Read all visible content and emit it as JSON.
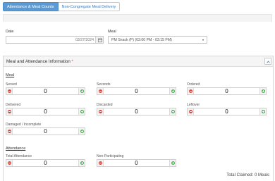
{
  "tabs": [
    {
      "label": "Attendance & Meal Counts",
      "active": true
    },
    {
      "label": "Non-Congregate Meal Delivery",
      "active": false
    }
  ],
  "date": {
    "label": "Date",
    "value": "03/27/2024",
    "icon": "calendar-icon"
  },
  "meal": {
    "label": "Meal",
    "value": "PM Snack (P) (03:00 PM - 03:15 PM)",
    "icon": "chevron-down-icon"
  },
  "panel": {
    "title": "Meal and Attendance Information",
    "required_mark": "*",
    "icon": "chevron-up-icon"
  },
  "meal_section": {
    "title": "Meal",
    "fields": [
      {
        "label": "Served",
        "value": "0"
      },
      {
        "label": "Seconds",
        "value": "0"
      },
      {
        "label": "Ordered",
        "value": "0"
      },
      {
        "label": "Delivered",
        "value": "0"
      },
      {
        "label": "Discarded",
        "value": "0"
      },
      {
        "label": "Leftover",
        "value": "0"
      },
      {
        "label": "Damaged / Incomplete",
        "value": "0"
      }
    ]
  },
  "attendance_section": {
    "title": "Attendance",
    "fields": [
      {
        "label": "Total Attendance",
        "value": "0"
      },
      {
        "label": "Non-Participating",
        "value": "0"
      }
    ]
  },
  "total_claimed": "Total Claimed: 0 Meals",
  "colors": {
    "accent": "#5b9bd5",
    "minus": "#e0463d",
    "plus": "#4caf50",
    "required": "#d9534f"
  }
}
